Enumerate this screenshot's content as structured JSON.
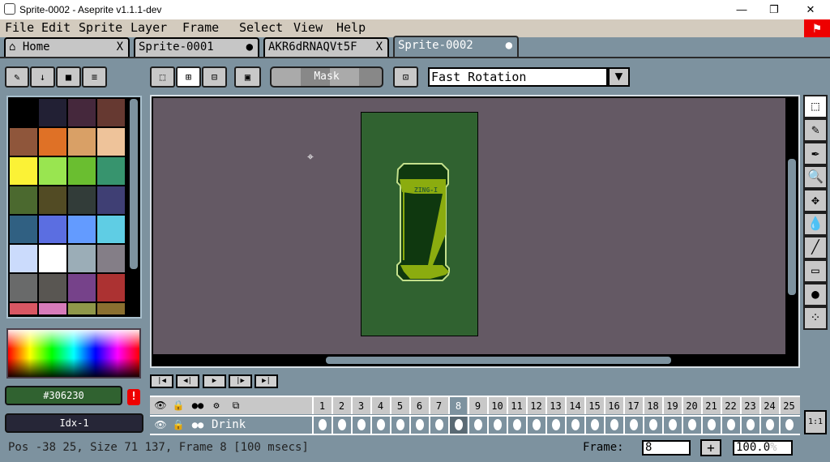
{
  "window": {
    "title": "Sprite-0002 - Aseprite v1.1.1-dev"
  },
  "menu": [
    "File",
    "Edit",
    "Sprite",
    "Layer",
    "Frame",
    "Select",
    "View",
    "Help"
  ],
  "tabs": [
    {
      "label": "Home",
      "close": "X"
    },
    {
      "label": "Sprite-0001",
      "close": "●"
    },
    {
      "label": "AKR6dRNAQVt5F",
      "close": "X"
    },
    {
      "label": "Sprite-0002",
      "close": "●"
    }
  ],
  "toolbar": {
    "mask_label": "Mask",
    "rotation_algorithm": "Fast Rotation"
  },
  "palette": [
    "#000000",
    "#222034",
    "#45283c",
    "#663931",
    "#8f563b",
    "#df7126",
    "#d9a066",
    "#eec39a",
    "#fbf236",
    "#99e550",
    "#6abe30",
    "#37946e",
    "#4b692f",
    "#524b24",
    "#323c39",
    "#3f3f74",
    "#306082",
    "#5b6ee1",
    "#639bff",
    "#5fcde4",
    "#cbdbfc",
    "#ffffff",
    "#9badb7",
    "#847e87",
    "#696a6a",
    "#595652",
    "#76428a",
    "#ac3232",
    "#d95763",
    "#d77bba",
    "#8f974a",
    "#8a6f30"
  ],
  "color": {
    "hex": "#306230",
    "index": "Idx-1",
    "warning": "!"
  },
  "timeline": {
    "layer": "Drink",
    "frames": [
      "1",
      "2",
      "3",
      "4",
      "5",
      "6",
      "7",
      "8",
      "9",
      "10",
      "11",
      "12",
      "13",
      "14",
      "15",
      "16",
      "17",
      "18",
      "19",
      "20",
      "21",
      "22",
      "23",
      "24",
      "25"
    ],
    "current_frame": 8,
    "one_to_one": "1:1"
  },
  "status": {
    "text": "Pos -38 25, Size 71 137, Frame 8 [100 msecs]",
    "frame_label": "Frame:",
    "frame_value": "8",
    "zoom": "100.0",
    "zoom_suffix": "%",
    "plus": "+"
  },
  "colors": {
    "canvas_bg": "#645964",
    "sprite_bg": "#306230"
  }
}
